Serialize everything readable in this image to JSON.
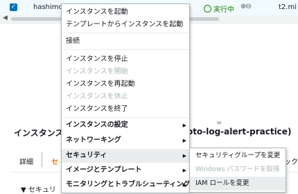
{
  "instance_row": {
    "name": "hashimoto-log-alert-practice",
    "state": "実行中",
    "zoom": "⊕⊖",
    "type": "t2.mi"
  },
  "background": {
    "resize_handle": "=",
    "detail_title": "インスタンス",
    "detail_title_tail": "oto-log-alert-practice)",
    "tab_detail": "詳細",
    "tab_security": "セ",
    "tab_right": "ック",
    "section_security": "▼ セキュリ"
  },
  "menu": {
    "items": [
      {
        "label": "インスタンスを起動"
      },
      {
        "label": "テンプレートからインスタンスを起動"
      },
      {
        "label": "接続"
      },
      {
        "label": "インスタンスを停止"
      },
      {
        "label": "インスタンスを開始"
      },
      {
        "label": "インスタンスを再起動"
      },
      {
        "label": "インスタンスを休止"
      },
      {
        "label": "インスタンスを終了"
      },
      {
        "label": "インスタンスの設定"
      },
      {
        "label": "ネットワーキング"
      },
      {
        "label": "セキュリティ"
      },
      {
        "label": "イメージとテンプレート"
      },
      {
        "label": "モニタリングとトラブルシューティング"
      }
    ]
  },
  "submenu": {
    "items": [
      {
        "label": "セキュリティグループを変更"
      },
      {
        "label": "Windows パスワードを取得"
      },
      {
        "label": "IAM ロールを変更"
      }
    ]
  },
  "colors": {
    "accent": "#0073bb",
    "running": "#1d8102",
    "tab_active": "#ec7211",
    "disabled": "#aab7b8"
  }
}
